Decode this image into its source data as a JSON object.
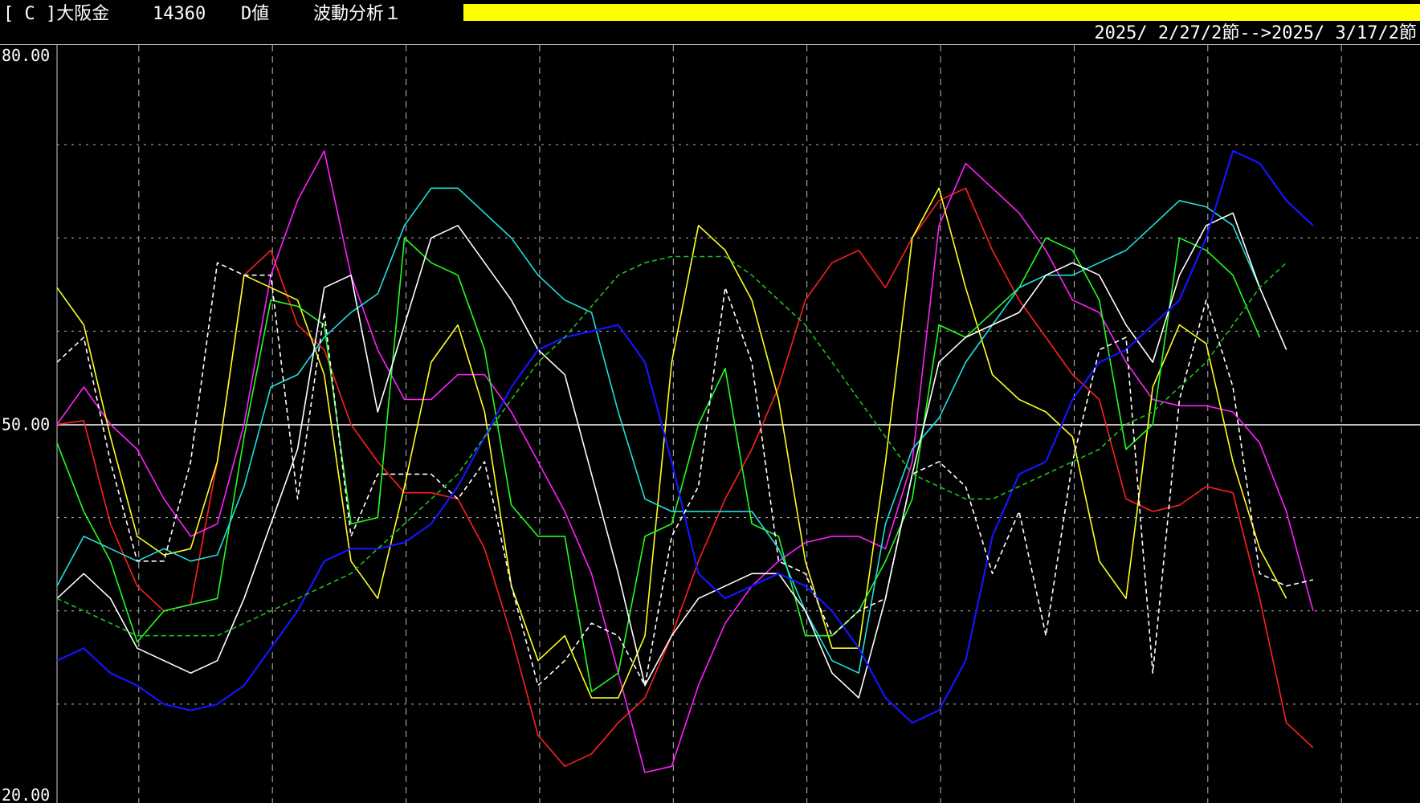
{
  "header": {
    "instrument_label": "[ C ]大阪金",
    "price": "14360",
    "mode": "D値",
    "analysis": "波動分析１",
    "date_range": "2025/ 2/27/2節-->2025/ 3/17/2節",
    "accent_color": "#ffff00"
  },
  "chart_data": {
    "type": "line",
    "title": "",
    "xlabel": "",
    "ylabel": "",
    "ylim": [
      20,
      80
    ],
    "yticks": [
      {
        "value": 80,
        "label": "80.00"
      },
      {
        "value": 50,
        "label": "50.00"
      },
      {
        "value": 20,
        "label": "20.00"
      }
    ],
    "grid": true,
    "reference_line": 50,
    "n_points": 52,
    "series": [
      {
        "color": "#ff2020",
        "dashed": false,
        "values": [
          50,
          50.3,
          42,
          37,
          35,
          35.5,
          47,
          62,
          64,
          58,
          56,
          50,
          47,
          44.5,
          44.5,
          44,
          40,
          33,
          25,
          22.5,
          23.5,
          26,
          28,
          33,
          39,
          44,
          48,
          53,
          60,
          63,
          64,
          61,
          65,
          68,
          69,
          64,
          60,
          57,
          54,
          52,
          44,
          43,
          43.5,
          45,
          44.5,
          36,
          26,
          24
        ]
      },
      {
        "color": "#ff20ff",
        "dashed": false,
        "values": [
          50,
          53,
          50,
          48,
          44,
          41,
          42,
          50,
          62,
          68,
          72,
          62,
          56,
          52,
          52,
          54,
          54,
          51,
          47,
          43,
          38,
          30,
          22,
          22.5,
          29,
          34,
          37,
          39,
          40.5,
          41,
          41,
          40,
          47,
          66,
          71,
          69,
          67,
          64,
          60,
          59,
          55,
          52,
          51.5,
          51.5,
          51,
          48.5,
          43,
          35
        ]
      },
      {
        "color": "#ffff20",
        "dashed": false,
        "values": [
          61,
          58,
          49,
          41,
          39.5,
          40,
          47,
          62,
          61,
          60,
          54,
          39,
          36,
          45,
          55,
          58,
          51,
          37,
          31,
          33,
          28,
          28,
          33,
          55,
          66,
          64,
          60,
          52,
          39,
          32,
          32,
          47,
          65,
          69,
          61,
          54,
          52,
          51,
          49,
          39,
          36,
          53,
          58,
          56.5,
          47,
          40,
          36
        ]
      },
      {
        "color": "#20ff20",
        "dashed": false,
        "values": [
          48.5,
          43,
          39,
          32.5,
          35,
          35.5,
          36,
          49,
          60,
          59.5,
          58,
          42,
          42.5,
          65,
          63,
          62,
          56,
          43.5,
          41,
          41,
          28.5,
          30,
          41,
          42,
          50,
          54.5,
          42,
          41,
          33,
          33,
          35,
          39,
          44,
          58,
          57,
          59,
          61,
          65,
          64,
          60,
          48,
          50,
          65,
          64,
          62,
          57
        ]
      },
      {
        "color": "#20e0e0",
        "dashed": false,
        "values": [
          37,
          41,
          40,
          39,
          40,
          39,
          39.5,
          45,
          53,
          54,
          57,
          59,
          60.5,
          66,
          69,
          69,
          67,
          65,
          62,
          60,
          59,
          51,
          44,
          43,
          43,
          43,
          43,
          40,
          35,
          31,
          30,
          42,
          48,
          50.5,
          55,
          58,
          61,
          62,
          62,
          63,
          64,
          66,
          68,
          67.5,
          66,
          61
        ]
      },
      {
        "color": "#ffffff",
        "dashed": false,
        "values": [
          36,
          38,
          36,
          32,
          31,
          30,
          31,
          36,
          42,
          48,
          61,
          62,
          51,
          58,
          65,
          66,
          63,
          60,
          56,
          54,
          46,
          38,
          29,
          33,
          36,
          37,
          38,
          38,
          35,
          30,
          28,
          36,
          46,
          55,
          57,
          58,
          59,
          62,
          63,
          62,
          58,
          55,
          62,
          66,
          67,
          61,
          56
        ]
      },
      {
        "color": "#1414ff",
        "dashed": false,
        "values": [
          31,
          32,
          30,
          29,
          27.5,
          27,
          27.5,
          29,
          32,
          35,
          39,
          40,
          40,
          40.5,
          42,
          45,
          49,
          53,
          56,
          57,
          57.5,
          58,
          55,
          47,
          38,
          36,
          37,
          38,
          37,
          35,
          32,
          28,
          26,
          27,
          31,
          41,
          46,
          47,
          52,
          55,
          56,
          58,
          60,
          65,
          72,
          71,
          68,
          66
        ]
      },
      {
        "color": "#ffffff",
        "dashed": true,
        "values": [
          55,
          57,
          47,
          39,
          39,
          47,
          63,
          62,
          62,
          44,
          59,
          41,
          46,
          46,
          46,
          44,
          47,
          37,
          29,
          31,
          34,
          33,
          29,
          41,
          45,
          61,
          55,
          39,
          38,
          33,
          35,
          36,
          46,
          47,
          45,
          38,
          43,
          33,
          47,
          56,
          57,
          30,
          52,
          60,
          53,
          38,
          37,
          37.5
        ]
      },
      {
        "color": "#20c020",
        "dashed": true,
        "values": [
          36,
          35,
          34,
          33,
          33,
          33,
          33,
          34,
          35,
          36,
          37,
          38,
          40,
          42,
          44,
          46,
          49,
          52,
          55,
          57,
          59.5,
          62,
          63,
          63.5,
          63.5,
          63.5,
          62,
          60,
          58,
          55,
          52,
          49,
          46,
          45,
          44,
          44,
          45,
          46,
          47,
          48,
          50,
          51,
          53,
          55,
          58,
          61,
          63
        ]
      }
    ]
  }
}
